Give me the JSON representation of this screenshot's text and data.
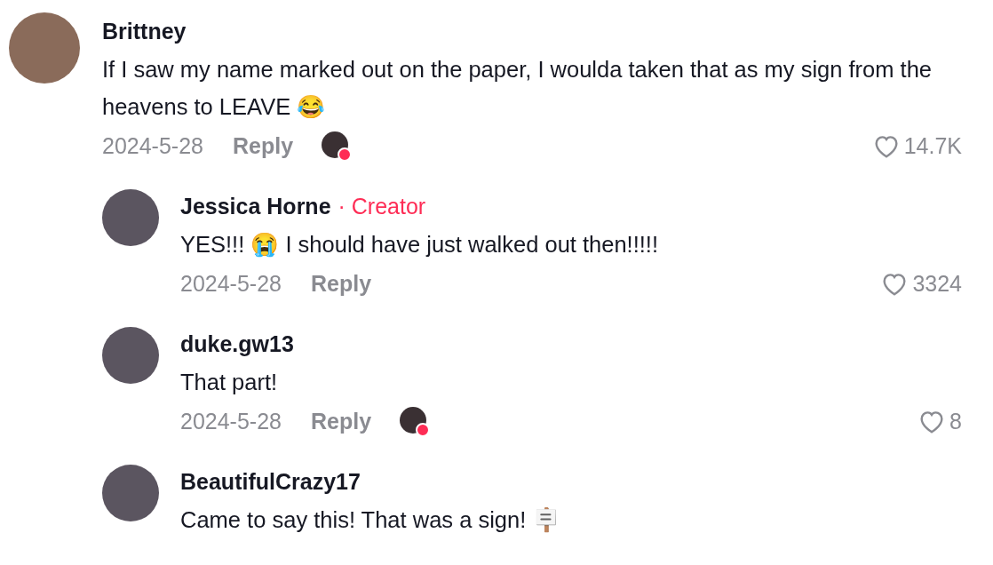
{
  "comments": [
    {
      "author": "Brittney",
      "text": "If I saw my name marked out on the paper, I woulda taken that as my sign from the heavens to LEAVE 😂",
      "date": "2024-5-28",
      "reply_label": "Reply",
      "liked_by_creator": true,
      "likes": "14.7K",
      "children": [
        {
          "author": "Jessica Horne",
          "badge": "· Creator",
          "text": "YES!!! 😭 I should have just walked out then!!!!!",
          "date": "2024-5-28",
          "reply_label": "Reply",
          "liked_by_creator": false,
          "likes": "3324"
        },
        {
          "author": "duke.gw13",
          "text": "That part!",
          "date": "2024-5-28",
          "reply_label": "Reply",
          "liked_by_creator": true,
          "likes": "8"
        },
        {
          "author": "BeautifulCrazy17",
          "text": "Came to say this! That was a sign! 🪧"
        }
      ]
    }
  ]
}
